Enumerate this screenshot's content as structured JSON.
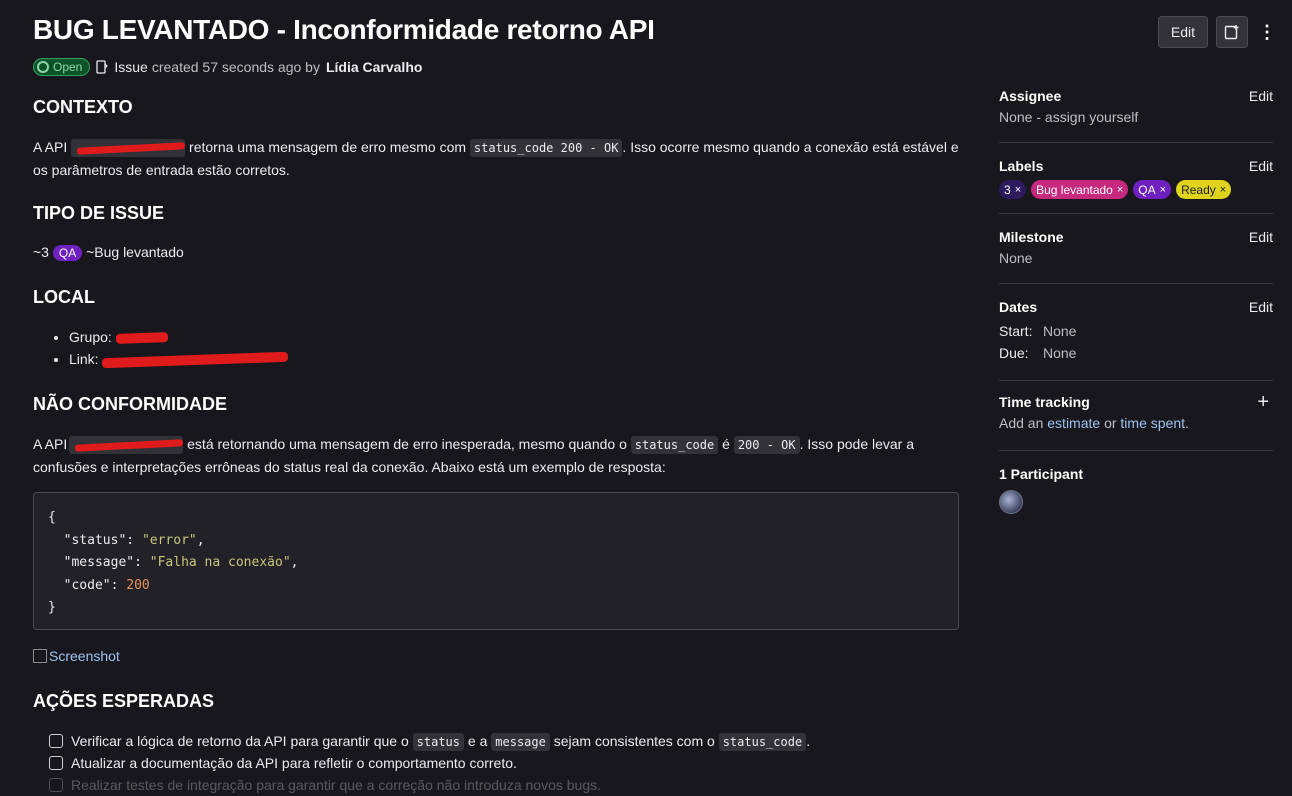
{
  "issue": {
    "title": "BUG LEVANTADO - Inconformidade retorno API",
    "status": "Open",
    "type": "Issue",
    "created_text": "created 57 seconds ago by",
    "author": "Lídia Carvalho"
  },
  "topbar": {
    "edit_label": "Edit"
  },
  "contexto": {
    "heading": "CONTEXTO",
    "p1_a": "A API",
    "p1_b": "retorna uma mensagem de erro mesmo com",
    "p1_code": "status_code 200 - OK",
    "p1_c": ". Isso ocorre mesmo quando a conexão está estável e os parâmetros de entrada estão corretos."
  },
  "tipo": {
    "heading": "TIPO DE ISSUE",
    "a": "~3",
    "pill": "QA",
    "b": "~Bug levantado"
  },
  "local": {
    "heading": "LOCAL",
    "items": [
      "Grupo:",
      "Link:"
    ]
  },
  "nao_conf": {
    "heading": "NÃO CONFORMIDADE",
    "a": "A API",
    "b": "está retornando uma mensagem de erro inesperada, mesmo quando o",
    "code1": "status_code",
    "c": "é",
    "code2": "200 - OK",
    "d": ". Isso pode levar a confusões e interpretações errôneas do status real da conexão. Abaixo está um exemplo de resposta:"
  },
  "code_example": {
    "open": "{",
    "k1": "\"status\"",
    "v1": "\"error\"",
    "k2": "\"message\"",
    "v2": "\"Falha na conexão\"",
    "k3": "\"code\"",
    "v3": "200",
    "close": "}"
  },
  "screenshot_alt": "Screenshot",
  "acoes": {
    "heading": "AÇÕES ESPERADAS",
    "t1_a": "Verificar a lógica de retorno da API para garantir que o",
    "t1_code1": "status",
    "t1_b": "e a",
    "t1_code2": "message",
    "t1_c": "sejam consistentes com o",
    "t1_code3": "status_code",
    "t1_d": ".",
    "t2": "Atualizar a documentação da API para refletir o comportamento correto.",
    "t3": "Realizar testes de integração para garantir que a correção não introduza novos bugs."
  },
  "sidebar": {
    "edit": "Edit",
    "assignee": {
      "title": "Assignee",
      "value": "None - assign yourself"
    },
    "labels": {
      "title": "Labels",
      "items": [
        {
          "text": "3",
          "color": "#2b1a5e"
        },
        {
          "text": "Bug levantado",
          "color": "#c6297d"
        },
        {
          "text": "QA",
          "color": "#6e20c0"
        },
        {
          "text": "Ready",
          "color": "#dfd31b"
        }
      ]
    },
    "milestone": {
      "title": "Milestone",
      "value": "None"
    },
    "dates": {
      "title": "Dates",
      "start_label": "Start:",
      "start": "None",
      "due_label": "Due:",
      "due": "None"
    },
    "time": {
      "title": "Time tracking",
      "add": "Add an",
      "estimate": "estimate",
      "or": "or",
      "spent": "time spent",
      "dot": ".",
      "plus": "+"
    },
    "participants": {
      "title": "1 Participant"
    }
  }
}
